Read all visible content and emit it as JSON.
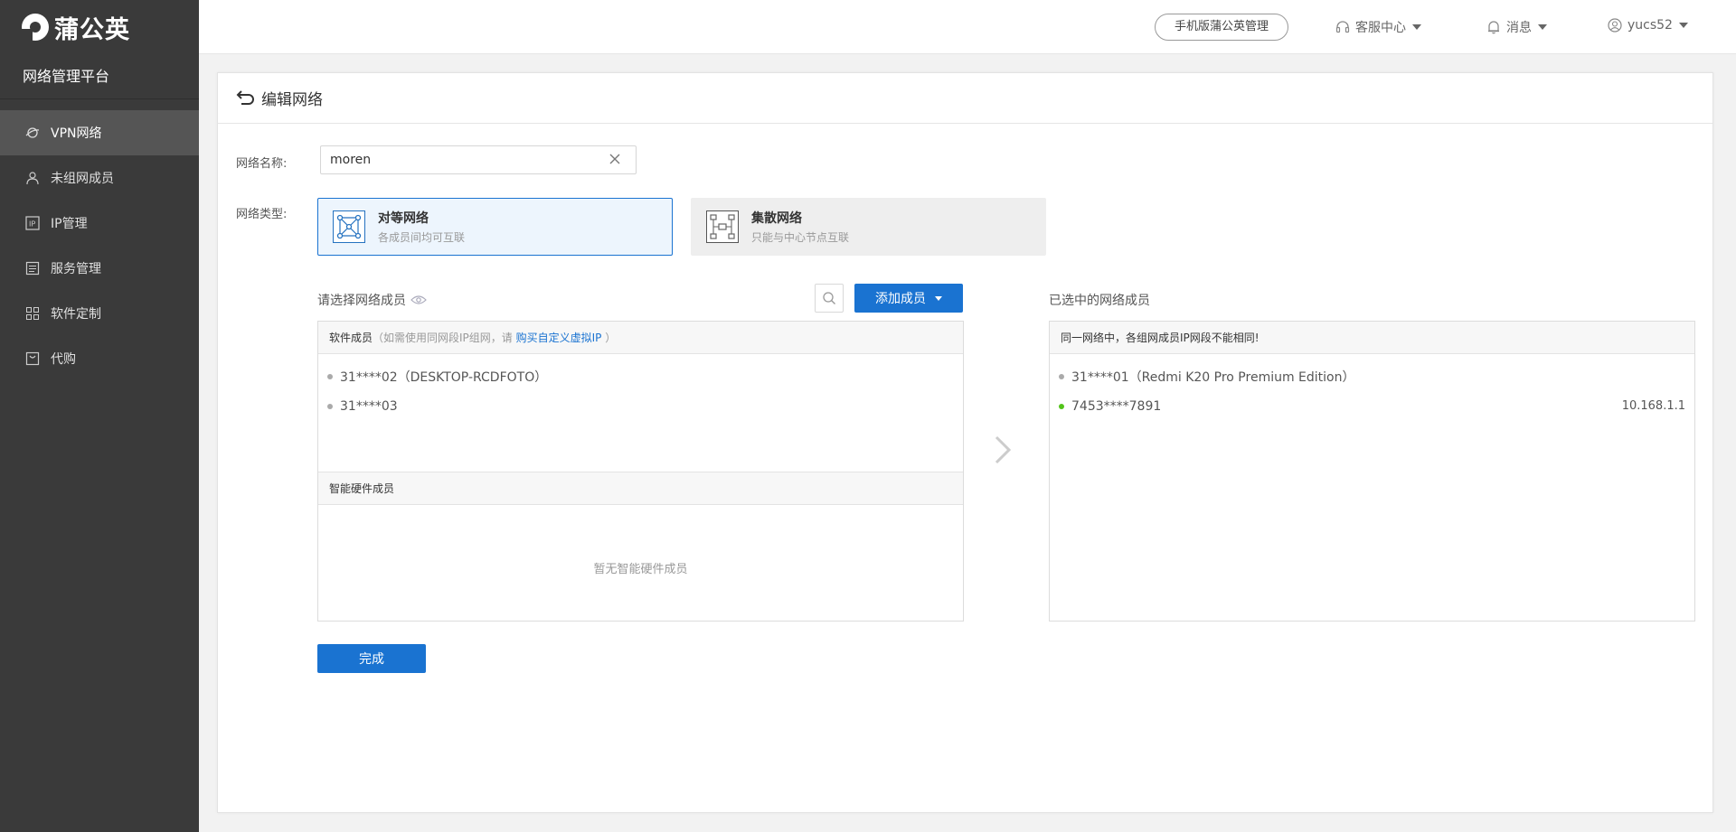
{
  "brand": {
    "name": "蒲公英",
    "platform": "网络管理平台"
  },
  "sidebar": {
    "items": [
      {
        "label": "VPN网络",
        "icon": "vpn-network-icon",
        "active": true
      },
      {
        "label": "未组网成员",
        "icon": "user-icon",
        "active": false
      },
      {
        "label": "IP管理",
        "icon": "ip-icon",
        "active": false
      },
      {
        "label": "服务管理",
        "icon": "service-list-icon",
        "active": false
      },
      {
        "label": "软件定制",
        "icon": "apps-grid-icon",
        "active": false
      },
      {
        "label": "代购",
        "icon": "purchase-icon",
        "active": false
      }
    ]
  },
  "header": {
    "mobile_btn": "手机版蒲公英管理",
    "support": "客服中心",
    "messages": "消息",
    "user": "yucs52"
  },
  "page": {
    "title": "编辑网络",
    "name_label": "网络名称:",
    "name_value": "moren",
    "type_label": "网络类型:",
    "types": [
      {
        "title": "对等网络",
        "desc": "各成员间均可互联",
        "selected": true
      },
      {
        "title": "集散网络",
        "desc": "只能与中心节点互联",
        "selected": false
      }
    ]
  },
  "left_panel": {
    "title": "请选择网络成员",
    "add_btn": "添加成员",
    "software_head": "软件成员",
    "software_note_prefix": "（如需使用同网段IP组网，请 ",
    "software_note_link": "购买自定义虚拟IP",
    "software_note_suffix": " ）",
    "software_members": [
      {
        "name": "31****02（DESKTOP-RCDFOTO）"
      },
      {
        "name": "31****03"
      }
    ],
    "hardware_head": "智能硬件成员",
    "hardware_empty": "暂无智能硬件成员"
  },
  "right_panel": {
    "title": "已选中的网络成员",
    "notice": "同一网络中，各组网成员IP网段不能相同!",
    "members": [
      {
        "name": "31****01（Redmi K20 Pro Premium Edition）",
        "ip": "",
        "online": false
      },
      {
        "name": "7453****7891",
        "ip": "10.168.1.1",
        "online": true
      }
    ]
  },
  "done_btn": "完成",
  "colors": {
    "primary": "#1a73d1",
    "sidebar_bg": "#3a3a3a",
    "online": "#52c41a"
  }
}
